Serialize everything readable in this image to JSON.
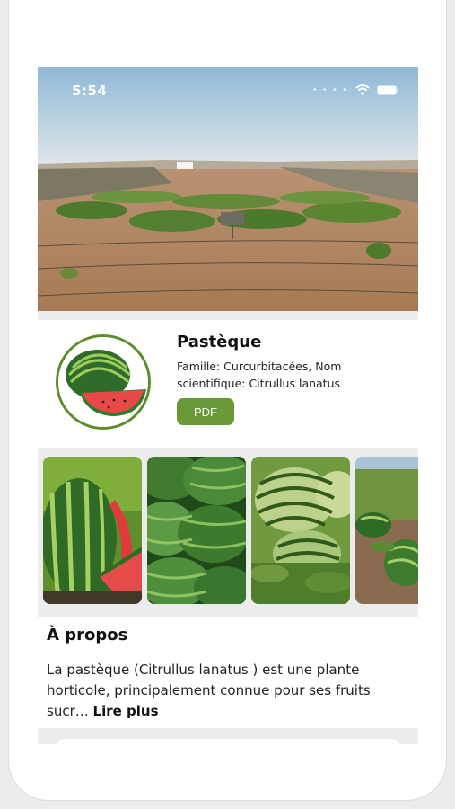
{
  "status_bar": {
    "time": "5:54"
  },
  "plant": {
    "name": "Pastèque",
    "family_line": "Famille: Curcurbitacées, Nom scientifique: Citrullus lanatus",
    "pdf_label": "PDF"
  },
  "gallery": {
    "images": [
      {
        "name": "gallery-image-1",
        "subject": "watermelon cut open"
      },
      {
        "name": "gallery-image-2",
        "subject": "pile of watermelons"
      },
      {
        "name": "gallery-image-3",
        "subject": "striped watermelons in field"
      },
      {
        "name": "gallery-image-4",
        "subject": "watermelon plantation"
      }
    ]
  },
  "about": {
    "title": "À propos",
    "text": "La pastèque (Citrullus lanatus ) est une plante horticole, principalement connue pour ses fruits sucr…",
    "read_more": "Lire plus"
  },
  "colors": {
    "accent": "#6a9a38",
    "avatar_border": "#5c8d2c",
    "background": "#ececec"
  }
}
